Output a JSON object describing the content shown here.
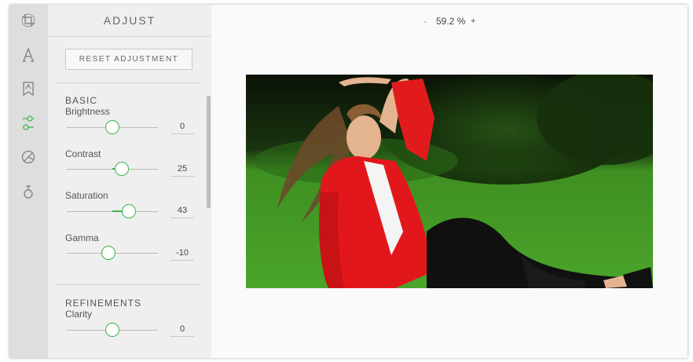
{
  "panel": {
    "title": "ADJUST",
    "reset_label": "RESET ADJUSTMENT"
  },
  "rail": {
    "icons": [
      "crop-icon",
      "text-icon",
      "sticker-icon",
      "adjust-icon",
      "filter-icon",
      "focus-icon"
    ]
  },
  "basic": {
    "title": "BASIC",
    "brightness": {
      "label": "Brightness",
      "value": "0",
      "level": 0.5
    },
    "contrast": {
      "label": "Contrast",
      "value": "25",
      "level": 0.6
    },
    "saturation": {
      "label": "Saturation",
      "value": "43",
      "level": 0.68
    },
    "gamma": {
      "label": "Gamma",
      "value": "-10",
      "level": 0.46
    }
  },
  "refinements": {
    "title": "REFINEMENTS",
    "clarity": {
      "label": "Clarity",
      "value": "0",
      "level": 0.5
    }
  },
  "zoom": {
    "minus": "-",
    "value": "59.2 %",
    "plus": "+"
  },
  "colors": {
    "accent": "#39b54a"
  }
}
